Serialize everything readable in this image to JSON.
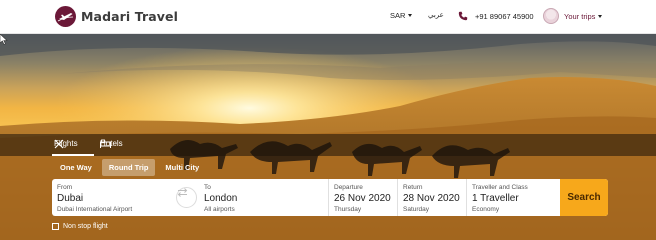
{
  "header": {
    "brand": "Madari Travel",
    "currency": "SAR",
    "language": "عربي",
    "phone": "+91 89067 45900",
    "trips_label": "Your trips"
  },
  "icons": [
    "plane-logo-icon",
    "phone-icon",
    "avatar-icon",
    "cursor-icon",
    "flights-icon",
    "hotels-icon",
    "swap-icon"
  ],
  "colors": {
    "brand": "#6b1838",
    "accent": "#f7a81b"
  },
  "tabs": [
    {
      "label": "Flights",
      "active": true
    },
    {
      "label": "Hotels",
      "active": false
    }
  ],
  "trip_types": [
    {
      "label": "One Way",
      "active": false
    },
    {
      "label": "Round Trip",
      "active": true
    },
    {
      "label": "Multi City",
      "active": false
    }
  ],
  "search": {
    "from": {
      "label": "From",
      "value": "Dubai",
      "sub": "Dubai International Airport"
    },
    "to": {
      "label": "To",
      "value": "London",
      "sub": "All airports"
    },
    "departure": {
      "label": "Departure",
      "value": "26 Nov 2020",
      "sub": "Thursday"
    },
    "return": {
      "label": "Return",
      "value": "28 Nov 2020",
      "sub": "Saturday"
    },
    "traveller": {
      "label": "Traveller and Class",
      "value": "1 Traveller",
      "sub": "Economy"
    },
    "button": "Search"
  },
  "nonstop_label": "Non stop flight"
}
